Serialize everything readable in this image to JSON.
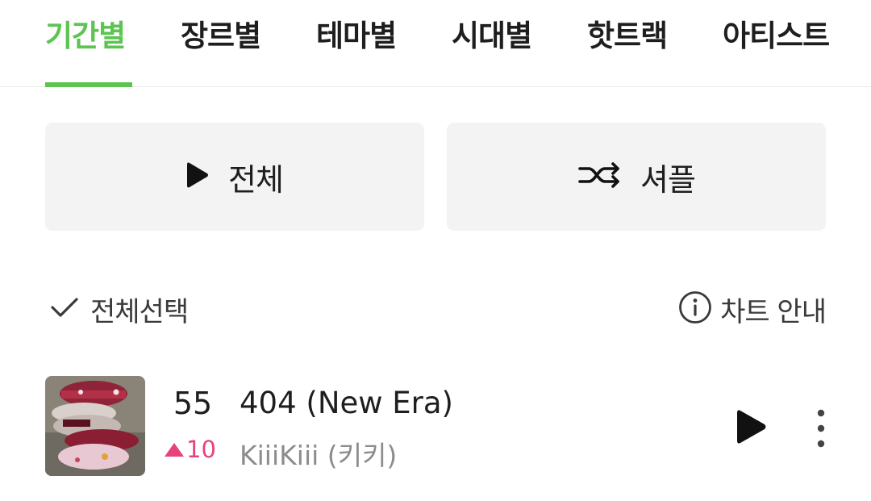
{
  "tabs": [
    {
      "label": "기간별",
      "active": true
    },
    {
      "label": "장르별",
      "active": false
    },
    {
      "label": "테마별",
      "active": false
    },
    {
      "label": "시대별",
      "active": false
    },
    {
      "label": "핫트랙",
      "active": false
    },
    {
      "label": "아티스트",
      "active": false
    }
  ],
  "actions": {
    "play_all_label": "전체",
    "shuffle_label": "셔플"
  },
  "list_header": {
    "select_all_label": "전체선택",
    "chart_guide_label": "차트 안내"
  },
  "tracks": [
    {
      "rank": "55",
      "rank_change": "10",
      "rank_direction": "up",
      "title": "404 (New Era)",
      "artist": "KiiiKiii (키키)"
    }
  ],
  "colors": {
    "accent_green": "#5cc451",
    "rank_up_pink": "#e6427e",
    "button_bg": "#f3f3f3"
  },
  "icons": {
    "play_all": "play-icon",
    "shuffle": "shuffle-icon",
    "select_all": "check-icon",
    "chart_guide": "info-icon",
    "row_play": "play-icon",
    "row_more": "more-vertical-icon"
  }
}
